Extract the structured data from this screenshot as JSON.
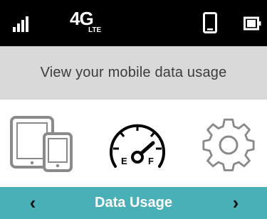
{
  "status_bar": {
    "signal_icon": "signal-bars-icon",
    "network_type": "4G",
    "network_subtype": "LTE",
    "device_icon": "device-icon",
    "battery_icon": "battery-icon"
  },
  "banner": {
    "text": "View your mobile data usage"
  },
  "carousel": {
    "items": [
      {
        "icon": "devices-icon"
      },
      {
        "icon": "fuel-gauge-icon",
        "gauge_empty_label": "E",
        "gauge_full_label": "F"
      },
      {
        "icon": "gear-icon"
      }
    ]
  },
  "nav": {
    "prev_label": "‹",
    "title": "Data Usage",
    "next_label": "›"
  },
  "colors": {
    "status_bar_bg": "#000000",
    "banner_bg": "#d9d9d9",
    "nav_bg": "#49b0b8",
    "icon_stroke": "#8a8a8a",
    "gauge_stroke": "#000000"
  }
}
